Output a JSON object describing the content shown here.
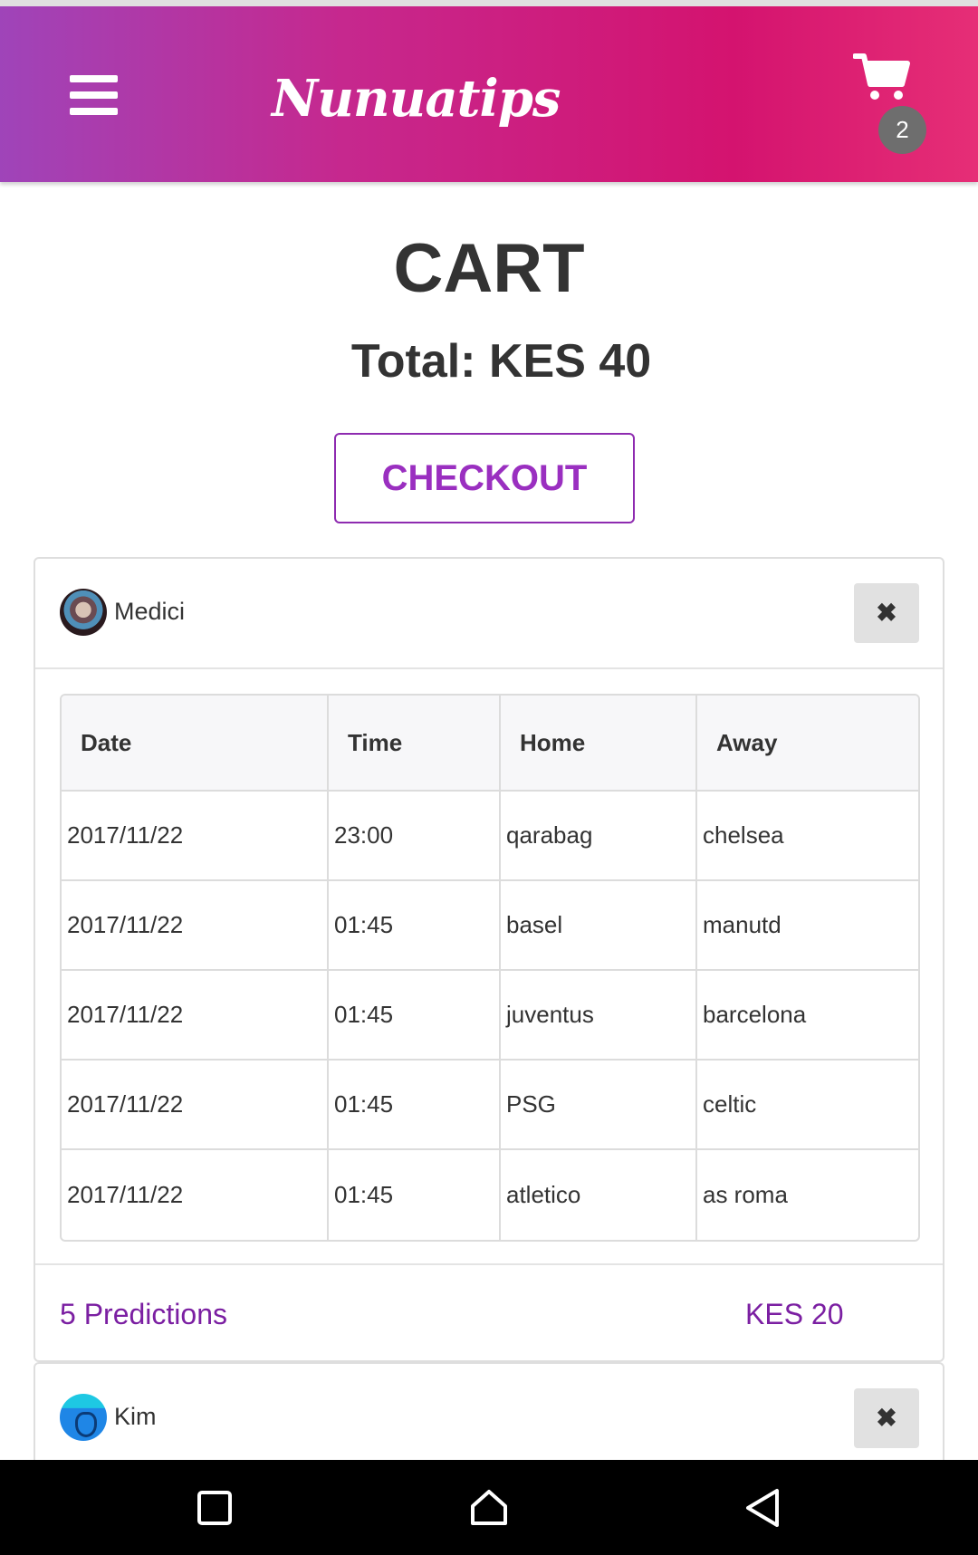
{
  "header": {
    "brand": "Nunuatips",
    "menu_icon": "hamburger-icon",
    "cart_icon": "shopping-cart-icon",
    "cart_count": "2"
  },
  "page": {
    "title": "CART",
    "total_label": "Total:",
    "total_value": "KES 40",
    "checkout_label": "CHECKOUT"
  },
  "cart_items": [
    {
      "seller": "Medici",
      "remove_label": "✖",
      "columns": [
        "Date",
        "Time",
        "Home",
        "Away"
      ],
      "rows": [
        [
          "2017/11/22",
          "23:00",
          "qarabag",
          "chelsea"
        ],
        [
          "2017/11/22",
          "01:45",
          "basel",
          "manutd"
        ],
        [
          "2017/11/22",
          "01:45",
          "juventus",
          "barcelona"
        ],
        [
          "2017/11/22",
          "01:45",
          "PSG",
          "celtic"
        ],
        [
          "2017/11/22",
          "01:45",
          "atletico",
          "as roma"
        ]
      ],
      "predictions_label": "5 Predictions",
      "price": "KES 20"
    },
    {
      "seller": "Kim",
      "remove_label": "✖"
    }
  ],
  "system_nav": {
    "recent_icon": "recent-apps-icon",
    "home_icon": "home-icon",
    "back_icon": "back-icon"
  },
  "colors": {
    "gradient_start": "#9f44b9",
    "gradient_end": "#e62e76",
    "accent_purple": "#7b1fa2",
    "badge_gray": "#6e6e6e"
  }
}
